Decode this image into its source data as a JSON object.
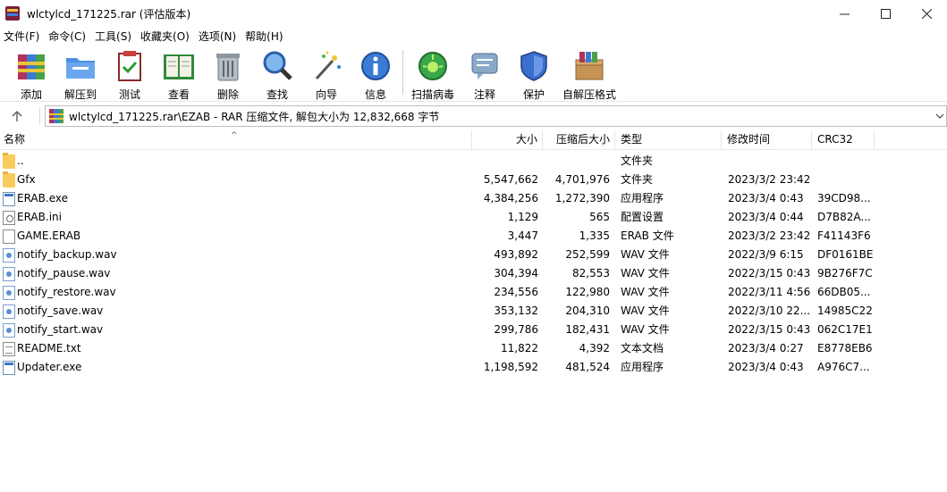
{
  "window": {
    "title": "wlctylcd_171225.rar (评估版本)",
    "minimize": "—",
    "maximize": "☐",
    "close": "✕"
  },
  "menu": [
    "文件(F)",
    "命令(C)",
    "工具(S)",
    "收藏夹(O)",
    "选项(N)",
    "帮助(H)"
  ],
  "toolbar": [
    {
      "label": "添加",
      "icon": "add-archive-icon"
    },
    {
      "label": "解压到",
      "icon": "extract-to-icon"
    },
    {
      "label": "测试",
      "icon": "test-icon"
    },
    {
      "label": "查看",
      "icon": "view-book-icon"
    },
    {
      "label": "删除",
      "icon": "trash-icon"
    },
    {
      "label": "查找",
      "icon": "magnifier-icon"
    },
    {
      "label": "向导",
      "icon": "wizard-wand-icon"
    },
    {
      "label": "信息",
      "icon": "info-icon"
    },
    {
      "label": "扫描病毒",
      "icon": "virus-scan-icon"
    },
    {
      "label": "注释",
      "icon": "comment-icon"
    },
    {
      "label": "保护",
      "icon": "shield-icon"
    },
    {
      "label": "自解压格式",
      "icon": "sfx-box-icon"
    }
  ],
  "address": {
    "up": "🡑",
    "path": "wlctylcd_171225.rar\\EZAB - RAR 压缩文件, 解包大小为 12,832,668 字节",
    "dropdown": "⌵"
  },
  "columns": {
    "name": "名称",
    "size": "大小",
    "packed": "压缩后大小",
    "type": "类型",
    "modified": "修改时间",
    "crc": "CRC32"
  },
  "files": [
    {
      "name": "..",
      "size": "",
      "packed": "",
      "type": "文件夹",
      "modified": "",
      "crc": "",
      "kind": "folder"
    },
    {
      "name": "Gfx",
      "size": "5,547,662",
      "packed": "4,701,976",
      "type": "文件夹",
      "modified": "2023/3/2 23:42",
      "crc": "",
      "kind": "folder"
    },
    {
      "name": "ERAB.exe",
      "size": "4,384,256",
      "packed": "1,272,390",
      "type": "应用程序",
      "modified": "2023/3/4 0:43",
      "crc": "39CD98...",
      "kind": "exe"
    },
    {
      "name": "ERAB.ini",
      "size": "1,129",
      "packed": "565",
      "type": "配置设置",
      "modified": "2023/3/4 0:44",
      "crc": "D7B82A...",
      "kind": "ini"
    },
    {
      "name": "GAME.ERAB",
      "size": "3,447",
      "packed": "1,335",
      "type": "ERAB 文件",
      "modified": "2023/3/2 23:42",
      "crc": "F41143F6",
      "kind": "doc"
    },
    {
      "name": "notify_backup.wav",
      "size": "493,892",
      "packed": "252,599",
      "type": "WAV 文件",
      "modified": "2022/3/9 6:15",
      "crc": "DF0161BE",
      "kind": "wav"
    },
    {
      "name": "notify_pause.wav",
      "size": "304,394",
      "packed": "82,553",
      "type": "WAV 文件",
      "modified": "2022/3/15 0:43",
      "crc": "9B276F7C",
      "kind": "wav"
    },
    {
      "name": "notify_restore.wav",
      "size": "234,556",
      "packed": "122,980",
      "type": "WAV 文件",
      "modified": "2022/3/11 4:56",
      "crc": "66DB05...",
      "kind": "wav"
    },
    {
      "name": "notify_save.wav",
      "size": "353,132",
      "packed": "204,310",
      "type": "WAV 文件",
      "modified": "2022/3/10 22...",
      "crc": "14985C22",
      "kind": "wav"
    },
    {
      "name": "notify_start.wav",
      "size": "299,786",
      "packed": "182,431",
      "type": "WAV 文件",
      "modified": "2022/3/15 0:43",
      "crc": "062C17E1",
      "kind": "wav"
    },
    {
      "name": "README.txt",
      "size": "11,822",
      "packed": "4,392",
      "type": "文本文档",
      "modified": "2023/3/4 0:27",
      "crc": "E8778EB6",
      "kind": "txt"
    },
    {
      "name": "Updater.exe",
      "size": "1,198,592",
      "packed": "481,524",
      "type": "应用程序",
      "modified": "2023/3/4 0:43",
      "crc": "A976C7...",
      "kind": "exe"
    }
  ]
}
